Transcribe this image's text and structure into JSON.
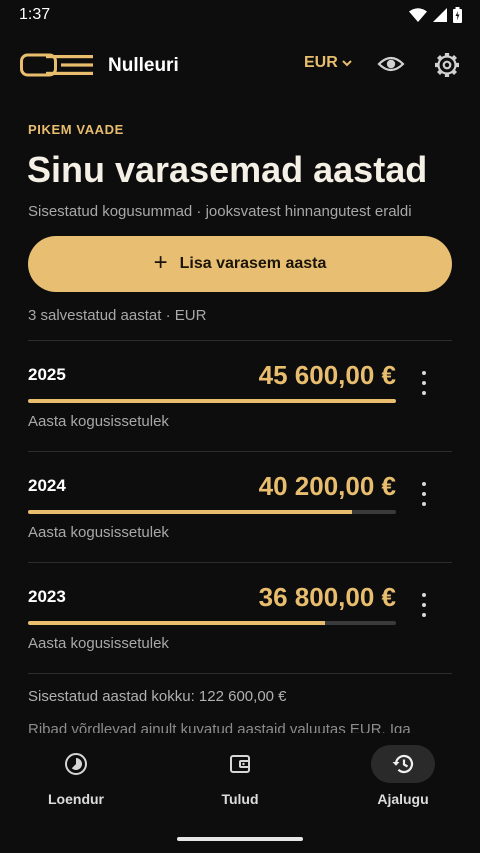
{
  "status_bar": {
    "time": "1:37"
  },
  "app_bar": {
    "title": "Nulleuri",
    "currency": "EUR"
  },
  "header": {
    "eyebrow": "PIKEM VAADE",
    "title": "Sinu varasemad aastad",
    "subtitle": "Sisestatud kogusummad · jooksvatest hinnangutest eraldi"
  },
  "add_button": {
    "label": "Lisa varasem aasta"
  },
  "summary": {
    "count": "3 salvestatud aastat · EUR"
  },
  "years": [
    {
      "year": "2025",
      "amount": "45 600,00 €",
      "caption": "Aasta kogusissetulek",
      "progress": 1.0
    },
    {
      "year": "2024",
      "amount": "40 200,00 €",
      "caption": "Aasta kogusissetulek",
      "progress": 0.8816
    },
    {
      "year": "2023",
      "amount": "36 800,00 €",
      "caption": "Aasta kogusissetulek",
      "progress": 0.807
    }
  ],
  "footer": {
    "total": "Sisestatud aastad kokku: 122 600,00 €",
    "note": "Ribad võrdlevad ainult kuvatud aastaid valuutas EUR. Iga"
  },
  "nav": {
    "items": [
      {
        "label": "Loendur",
        "icon": "timelapse-icon",
        "active": false
      },
      {
        "label": "Tulud",
        "icon": "wallet-icon",
        "active": false
      },
      {
        "label": "Ajalugu",
        "icon": "history-icon",
        "active": true
      }
    ]
  },
  "colors": {
    "accent": "#e8bd6e",
    "button": "#e8bf72",
    "background": "#0d0d0d"
  }
}
